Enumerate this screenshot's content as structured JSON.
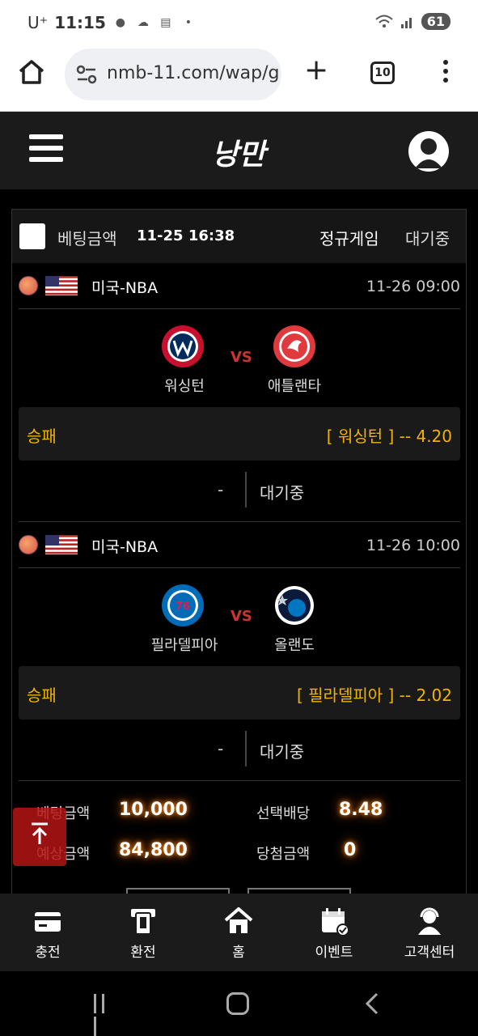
{
  "status_bar": {
    "carrier": "U⁺",
    "time": "11:15",
    "battery": "61"
  },
  "browser": {
    "url": "nmb-11.com/wap/g",
    "tab_count": "10"
  },
  "header": {
    "logo": "낭만"
  },
  "panel": {
    "label": "베팅금액",
    "datetime": "11-25 16:38",
    "game_type": "정규게임",
    "status": "대기중"
  },
  "games": [
    {
      "league": "미국-NBA",
      "time": "11-26 09:00",
      "home": "워싱턴",
      "away": "애틀랜타",
      "vs": "VS",
      "bet_type": "승패",
      "pick": "[ 워싱턴 ] -- 4.20",
      "score": "-",
      "result": "대기중"
    },
    {
      "league": "미국-NBA",
      "time": "11-26 10:00",
      "home": "필라델피아",
      "away": "올랜도",
      "vs": "VS",
      "bet_type": "승패",
      "pick": "[ 필라델피아 ] -- 2.02",
      "score": "-",
      "result": "대기중"
    }
  ],
  "summary": {
    "bet_amount_label": "베팅금액",
    "bet_amount": "10,000",
    "odds_label": "선택배당",
    "odds": "8.48",
    "expected_label": "예상금액",
    "expected": "84,800",
    "win_label": "당첨금액",
    "win": "0"
  },
  "bottom_nav": [
    {
      "label": "충전",
      "icon": "card-icon"
    },
    {
      "label": "환전",
      "icon": "withdraw-icon"
    },
    {
      "label": "홈",
      "icon": "home-icon"
    },
    {
      "label": "이벤트",
      "icon": "calendar-icon"
    },
    {
      "label": "고객센터",
      "icon": "support-icon"
    }
  ],
  "colors": {
    "accent": "#f0b400",
    "vs": "#cc3333",
    "top_button": "#b41414"
  }
}
